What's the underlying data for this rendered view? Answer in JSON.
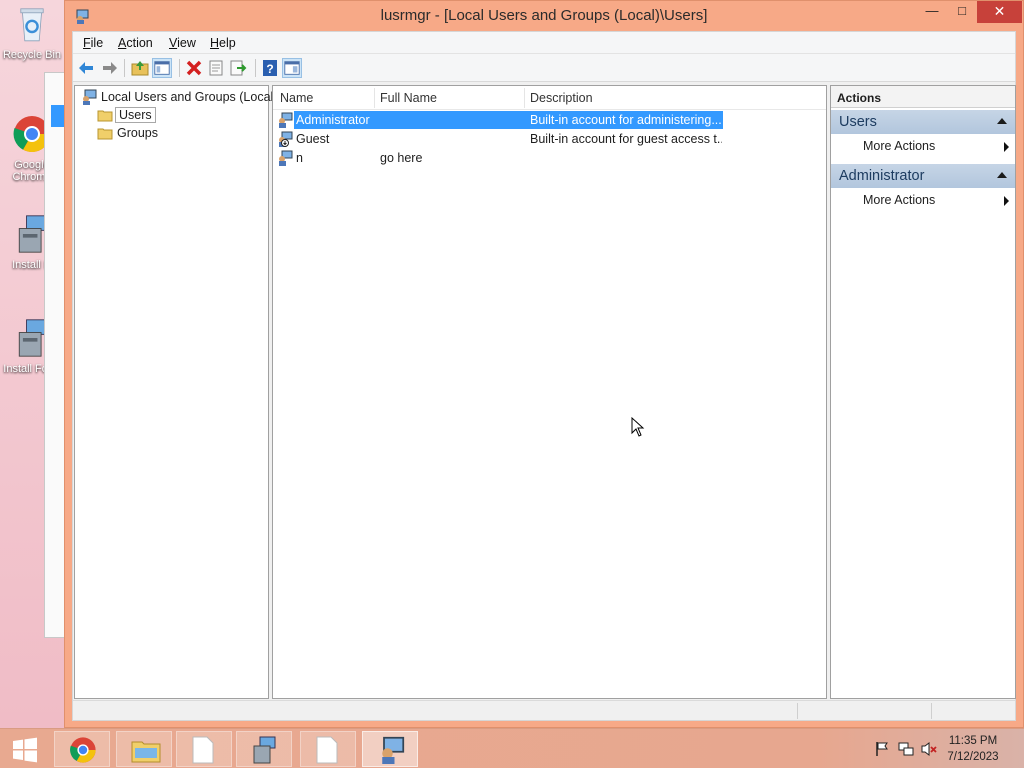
{
  "window": {
    "title": "lusrmgr - [Local Users and Groups (Local)\\Users]",
    "minimize": "—",
    "maximize": "□",
    "close": "✕"
  },
  "menu": {
    "file": "File",
    "action": "Action",
    "view": "View",
    "help": "Help"
  },
  "tree": {
    "root": "Local Users and Groups (Local)",
    "users": "Users",
    "groups": "Groups"
  },
  "list": {
    "columns": {
      "name": "Name",
      "full_name": "Full Name",
      "description": "Description"
    },
    "rows": [
      {
        "name": "Administrator",
        "full_name": "",
        "description": "Built-in account for administering..."
      },
      {
        "name": "Guest",
        "full_name": "",
        "description": "Built-in account for guest access t..."
      },
      {
        "name": "n",
        "full_name": "go here",
        "description": ""
      }
    ]
  },
  "actions": {
    "title": "Actions",
    "sections": [
      {
        "heading": "Users",
        "item": "More Actions"
      },
      {
        "heading": "Administrator",
        "item": "More Actions"
      }
    ]
  },
  "desktop": {
    "icons": [
      "Recycle Bin",
      "Google Chrome",
      "Install D",
      "Install Fortn"
    ]
  },
  "taskbar": {
    "time": "11:35 PM",
    "date": "7/12/2023"
  },
  "colors": {
    "selection": "#3399ff",
    "window_frame": "#f7a987",
    "close_button": "#c7413a",
    "actions_header": "#b2c6dd"
  },
  "icons": {
    "toolbar": [
      "back-icon",
      "forward-icon",
      "up-folder-icon",
      "show-hide-tree-icon",
      "delete-icon",
      "properties-icon",
      "export-list-icon",
      "help-icon",
      "show-hide-action-pane-icon"
    ]
  }
}
